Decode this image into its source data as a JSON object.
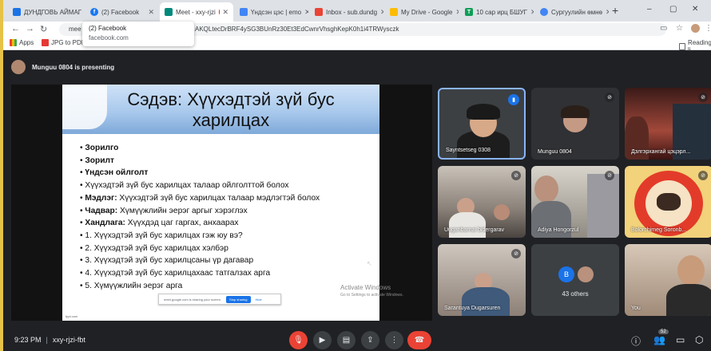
{
  "browser": {
    "tabs": [
      {
        "label": "ДУНДГОВЬ АЙМАГ",
        "color": "#1a73e8"
      },
      {
        "label": "(2) Facebook",
        "color": "#1877f2"
      },
      {
        "label": "Meet - xxy-rjzi",
        "color": "#00897b",
        "active": true
      },
      {
        "label": "Үндсэн цэс | emo",
        "color": "#4285f4"
      },
      {
        "label": "Inbox - sub.dundg",
        "color": "#ea4335"
      },
      {
        "label": "My Drive - Google",
        "color": "#fbbc04"
      },
      {
        "label": "10 сар ирц БШУГ",
        "color": "#0f9d58"
      },
      {
        "label": "Сургуулийн өмнө",
        "color": "#4285f4"
      }
    ],
    "new_tab": "+",
    "window_controls": {
      "minimize": "–",
      "maximize": "▢",
      "close": "✕"
    },
    "url_prefix": "mee",
    "url": "AKQLtecDrBRF4ySG3BUnRz30Et3EdCwnrVhsghKepK0h1i4TRWysczk",
    "bookmarks": {
      "apps": "Apps",
      "jpg_to_pdf": "JPG to PDF",
      "reading_list": "Reading li"
    },
    "tooltip": {
      "title": "(2) Facebook",
      "domain": "facebook.com"
    }
  },
  "meet": {
    "presenter_text": "Munguu 0804 is presenting",
    "slide": {
      "title": "Сэдэв: Хүүхэдтэй зүй бус харилцах",
      "items": [
        {
          "bold": "Зорилго",
          "text": ""
        },
        {
          "bold": "Зорилт",
          "text": ""
        },
        {
          "bold": "Үндсэн ойлголт",
          "text": ""
        },
        {
          "bold": "",
          "text": "Хүүхэдтэй зүй бус харилцах талаар ойлголттой болох"
        },
        {
          "bold": "Мэдлэг:",
          "text": " Хүүхэдтэй зүй бус харилцах талаар мэдлэгтэй болох"
        },
        {
          "bold": "Чадвар:",
          "text": " Хүмүүжлийн эерэг аргыг хэрэглэх"
        },
        {
          "bold": "Хандлага:",
          "text": " Хүүхдэд цаг гаргах, анхаарах"
        },
        {
          "bold": "",
          "text": "1. Хүүхэдтэй зүй бус харилцах гэж юу вэ?"
        },
        {
          "bold": "",
          "text": "2. Хүүхэдтэй зүй бус харилцах хэлбэр"
        },
        {
          "bold": "",
          "text": "3. Хүүхэдтэй зүй бус харилцсаны үр дагавар"
        },
        {
          "bold": "",
          "text": "4. Хүүхэдтэй зүй бус харилцахаас татгалзах арга"
        },
        {
          "bold": "",
          "text": "5. Хүмүүжлийн эерэг арга"
        }
      ],
      "share_bar": {
        "text": "meet.google.com is sharing your screen.",
        "stop": "Stop sharing",
        "hide": "Hide"
      },
      "footer": "fppt.com",
      "activate_title": "Activate Windows",
      "activate_sub": "Go to Settings to activate Windows."
    },
    "participants": [
      {
        "name": "Sayntsetseg 0308",
        "speaking": true
      },
      {
        "name": "Munguu 0804"
      },
      {
        "name": "Дэлгэрхангай цэцэрл..."
      },
      {
        "name": "Uuganbarnai bidergarav"
      },
      {
        "name": "Adiya Hongorzul"
      },
      {
        "name": "Bolorchimeg Soronb..."
      },
      {
        "name": "Sarantuya Dugarsuren"
      },
      {
        "name": "43 others",
        "avatar_letter": "B"
      },
      {
        "name": "You"
      }
    ],
    "bottom": {
      "time": "9:23 PM",
      "code": "xxy-rjzi-fbt",
      "participant_count": "52"
    }
  }
}
